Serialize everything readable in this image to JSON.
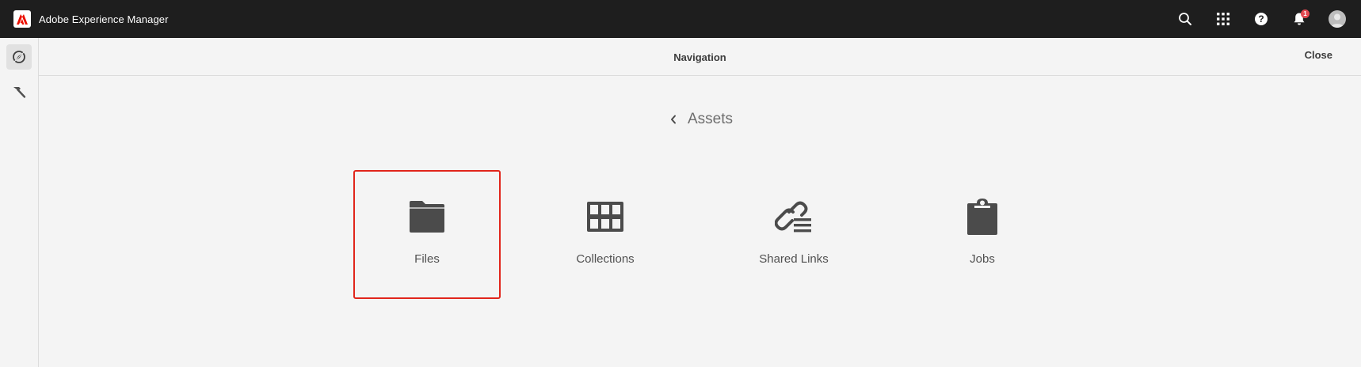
{
  "shell": {
    "app_title": "Adobe Experience Manager",
    "notification_count": "1",
    "icons": [
      "adobe-logo-icon",
      "search-icon",
      "apps-grid-icon",
      "help-icon",
      "bell-icon",
      "user-avatar-icon"
    ]
  },
  "rail": {
    "items": [
      {
        "icon": "navigation-compass-icon",
        "active": true
      },
      {
        "icon": "hammer-tools-icon",
        "active": false
      }
    ]
  },
  "header": {
    "title": "Navigation",
    "close_label": "Close"
  },
  "breadcrumb": {
    "label": "Assets"
  },
  "tiles": [
    {
      "label": "Files",
      "icon": "folder-icon",
      "selected": true
    },
    {
      "label": "Collections",
      "icon": "collections-grid-icon",
      "selected": false
    },
    {
      "label": "Shared Links",
      "icon": "shared-links-icon",
      "selected": false
    },
    {
      "label": "Jobs",
      "icon": "clipboard-icon",
      "selected": false
    }
  ],
  "colors": {
    "shell_bg": "#1e1e1e",
    "page_bg": "#f4f4f4",
    "selection_outline": "#e1251b",
    "badge": "#e34850"
  }
}
